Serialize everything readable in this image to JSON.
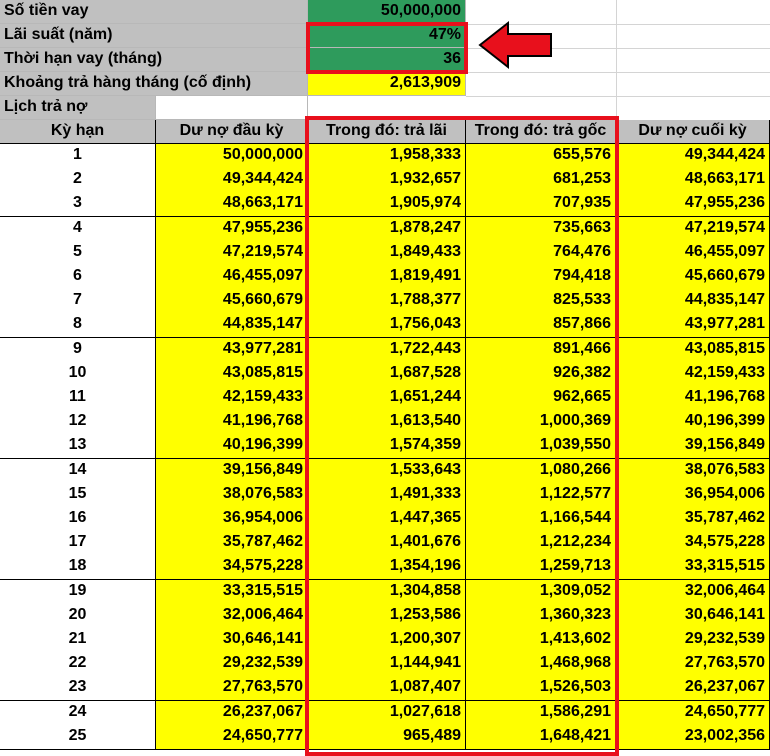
{
  "summary": {
    "loan_amount_label": "Số tiền vay",
    "loan_amount_value": "50,000,000",
    "interest_label": "Lãi suất (năm)",
    "interest_value": "47%",
    "term_label": "Thời hạn vay (tháng)",
    "term_value": "36",
    "monthly_label": "Khoảng trả hàng tháng (cố định)",
    "monthly_value": "2,613,909",
    "schedule_label": "Lịch trả nợ"
  },
  "table": {
    "headers": [
      "Kỳ hạn",
      "Dư nợ đầu kỳ",
      "Trong đó: trả lãi",
      "Trong đó: trả gốc",
      "Dư nợ cuối kỳ"
    ],
    "rows": [
      [
        "1",
        "50,000,000",
        "1,958,333",
        "655,576",
        "49,344,424"
      ],
      [
        "2",
        "49,344,424",
        "1,932,657",
        "681,253",
        "48,663,171"
      ],
      [
        "3",
        "48,663,171",
        "1,905,974",
        "707,935",
        "47,955,236"
      ],
      [
        "4",
        "47,955,236",
        "1,878,247",
        "735,663",
        "47,219,574"
      ],
      [
        "5",
        "47,219,574",
        "1,849,433",
        "764,476",
        "46,455,097"
      ],
      [
        "6",
        "46,455,097",
        "1,819,491",
        "794,418",
        "45,660,679"
      ],
      [
        "7",
        "45,660,679",
        "1,788,377",
        "825,533",
        "44,835,147"
      ],
      [
        "8",
        "44,835,147",
        "1,756,043",
        "857,866",
        "43,977,281"
      ],
      [
        "9",
        "43,977,281",
        "1,722,443",
        "891,466",
        "43,085,815"
      ],
      [
        "10",
        "43,085,815",
        "1,687,528",
        "926,382",
        "42,159,433"
      ],
      [
        "11",
        "42,159,433",
        "1,651,244",
        "962,665",
        "41,196,768"
      ],
      [
        "12",
        "41,196,768",
        "1,613,540",
        "1,000,369",
        "40,196,399"
      ],
      [
        "13",
        "40,196,399",
        "1,574,359",
        "1,039,550",
        "39,156,849"
      ],
      [
        "14",
        "39,156,849",
        "1,533,643",
        "1,080,266",
        "38,076,583"
      ],
      [
        "15",
        "38,076,583",
        "1,491,333",
        "1,122,577",
        "36,954,006"
      ],
      [
        "16",
        "36,954,006",
        "1,447,365",
        "1,166,544",
        "35,787,462"
      ],
      [
        "17",
        "35,787,462",
        "1,401,676",
        "1,212,234",
        "34,575,228"
      ],
      [
        "18",
        "34,575,228",
        "1,354,196",
        "1,259,713",
        "33,315,515"
      ],
      [
        "19",
        "33,315,515",
        "1,304,858",
        "1,309,052",
        "32,006,464"
      ],
      [
        "20",
        "32,006,464",
        "1,253,586",
        "1,360,323",
        "30,646,141"
      ],
      [
        "21",
        "30,646,141",
        "1,200,307",
        "1,413,602",
        "29,232,539"
      ],
      [
        "22",
        "29,232,539",
        "1,144,941",
        "1,468,968",
        "27,763,570"
      ],
      [
        "23",
        "27,763,570",
        "1,087,407",
        "1,526,503",
        "26,237,067"
      ],
      [
        "24",
        "26,237,067",
        "1,027,618",
        "1,586,291",
        "24,650,777"
      ],
      [
        "25",
        "24,650,777",
        "965,489",
        "1,648,421",
        "23,002,356"
      ]
    ]
  },
  "colors": {
    "header_grey": "#c0c0c0",
    "input_green": "#2e9b5c",
    "highlight_yellow": "#ffff00",
    "annotation_red": "#e8101c"
  }
}
